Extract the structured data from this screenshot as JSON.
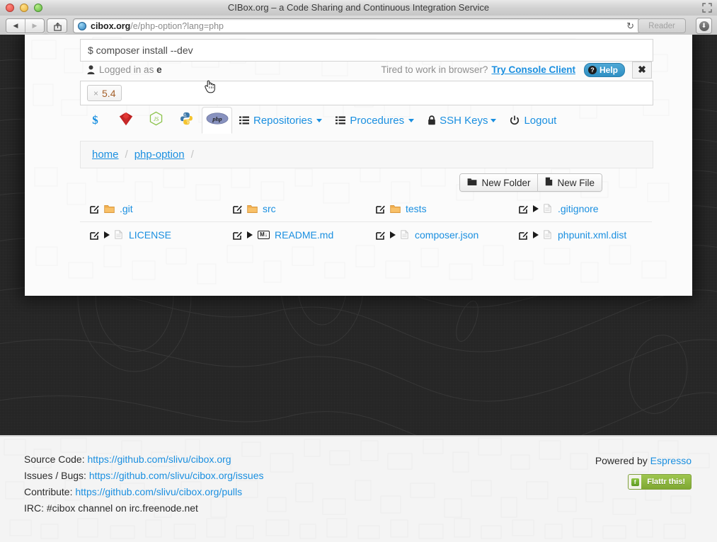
{
  "window": {
    "title": "CIBox.org – a Code Sharing and Continuous Integration Service",
    "traffic_lights": [
      "close",
      "minimize",
      "zoom"
    ]
  },
  "browser": {
    "back_label": "◀",
    "forward_label": "▶",
    "share_label": "share-icon",
    "url_host": "cibox.org",
    "url_path": "/e/php-option?lang=php",
    "reload_label": "↻",
    "reader_label": "Reader",
    "downloads_label": "⬇"
  },
  "console": {
    "command": "$ composer install --dev"
  },
  "status": {
    "logged_in_prefix": "Logged in as",
    "logged_in_user": "e",
    "tired_text": "Tired to work in browser?",
    "console_client_link": "Try Console Client",
    "help_label": "Help",
    "help_badge": "?",
    "close_label": "✖"
  },
  "tagfield": {
    "tags": [
      {
        "remove": "×",
        "label": "5.4"
      }
    ]
  },
  "nav": {
    "lang_tabs": [
      {
        "name": "shell",
        "label": "$",
        "active": false
      },
      {
        "name": "ruby",
        "label": "",
        "active": false
      },
      {
        "name": "nodejs",
        "label": "JS",
        "active": false
      },
      {
        "name": "python",
        "label": "",
        "active": false
      },
      {
        "name": "php",
        "label": "php",
        "active": true
      }
    ],
    "menu": [
      {
        "icon": "list-icon",
        "label": "Repositories",
        "caret": true
      },
      {
        "icon": "list-icon",
        "label": "Procedures",
        "caret": true
      },
      {
        "icon": "lock-icon",
        "label": "SSH Keys",
        "caret": true
      },
      {
        "icon": "power-icon",
        "label": "Logout",
        "caret": false
      }
    ]
  },
  "breadcrumb": {
    "items": [
      "home",
      "php-option"
    ],
    "separator": "/"
  },
  "actions": {
    "new_folder": "New Folder",
    "new_file": "New File"
  },
  "files": {
    "rows": [
      [
        {
          "name": ".git",
          "kind": "folder",
          "has_run": false
        },
        {
          "name": "src",
          "kind": "folder",
          "has_run": false
        },
        {
          "name": "tests",
          "kind": "folder",
          "has_run": false
        },
        {
          "name": ".gitignore",
          "kind": "file",
          "has_run": true
        }
      ],
      [
        {
          "name": "LICENSE",
          "kind": "file",
          "has_run": true
        },
        {
          "name": "README.md",
          "kind": "markdown",
          "has_run": true
        },
        {
          "name": "composer.json",
          "kind": "file",
          "has_run": true
        },
        {
          "name": "phpunit.xml.dist",
          "kind": "file",
          "has_run": true
        }
      ]
    ]
  },
  "footer": {
    "lines": [
      {
        "label": "Source Code:",
        "link": "https://github.com/slivu/cibox.org"
      },
      {
        "label": "Issues / Bugs:",
        "link": "https://github.com/slivu/cibox.org/issues"
      },
      {
        "label": "Contribute:",
        "link": "https://github.com/slivu/cibox.org/pulls"
      },
      {
        "label": "IRC: #cibox channel on irc.freenode.net",
        "link": ""
      }
    ],
    "powered_by_prefix": "Powered by",
    "powered_by_link": "Espresso",
    "flattr_label": "Flattr this!",
    "flattr_icon": "f"
  },
  "colors": {
    "link": "#1a8fe0",
    "accent_help": "#2f90c4",
    "tag_text": "#a4602a",
    "folder": "#f0ad4e",
    "page_bg": "#262626"
  }
}
